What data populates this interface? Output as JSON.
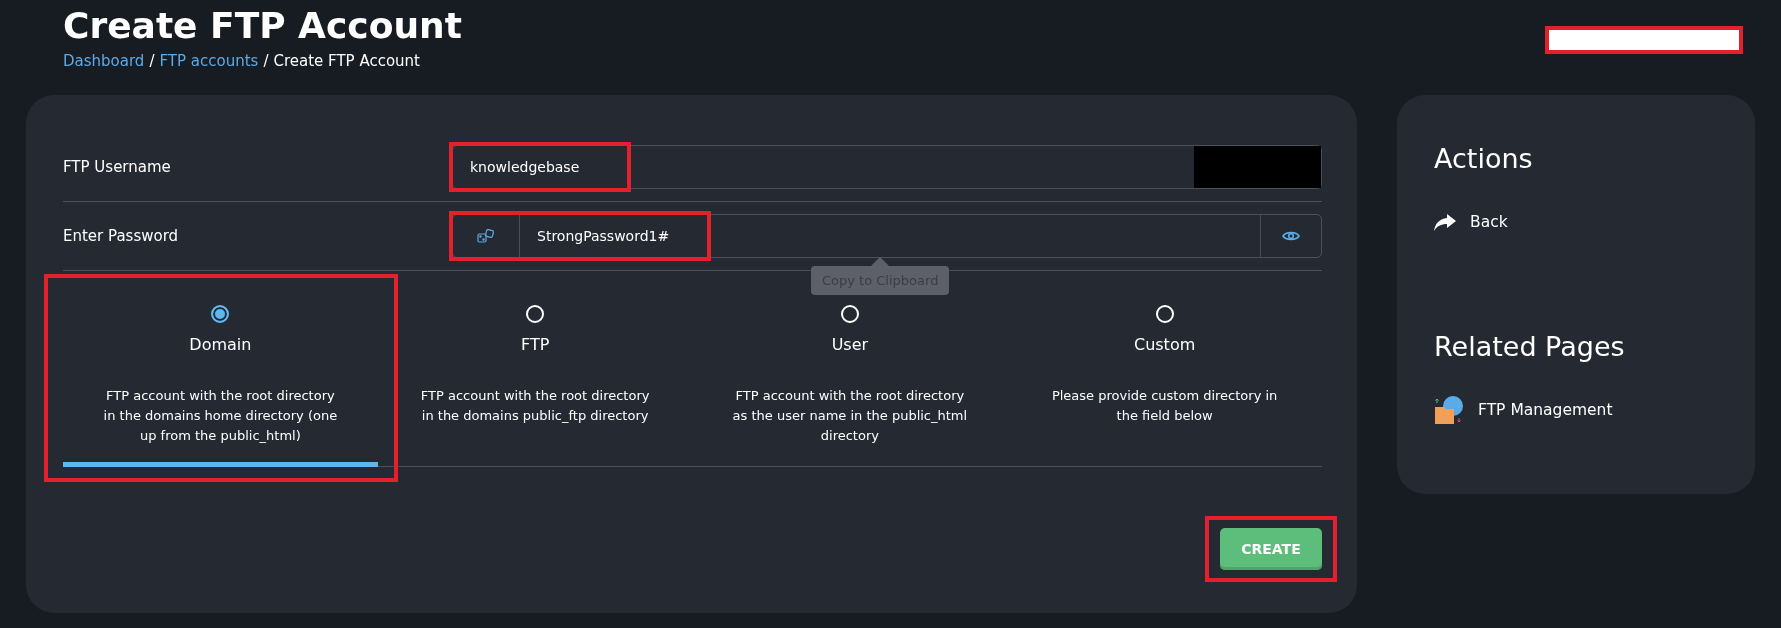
{
  "page": {
    "title": "Create FTP Account"
  },
  "breadcrumb": [
    {
      "label": "Dashboard",
      "kind": "link"
    },
    {
      "label": "/",
      "kind": "separator"
    },
    {
      "label": "FTP accounts",
      "kind": "link"
    },
    {
      "label": "/",
      "kind": "separator"
    },
    {
      "label": "Create FTP Account",
      "kind": "current"
    }
  ],
  "header_redacted": true,
  "form": {
    "fields": [
      {
        "kind": "text",
        "label": "FTP Username",
        "value": "knowledgebase",
        "redacted": true,
        "highlighted": true
      },
      {
        "kind": "password",
        "label": "Enter Password",
        "value": "StrongPassword1#",
        "highlighted": true,
        "tooltip": "Copy to Clipboard"
      }
    ],
    "directory_options": [
      {
        "label": "Domain",
        "description": "FTP account with the root directory\nin the domains home directory (one\nup from the public_html)",
        "selected": true,
        "highlighted": true
      },
      {
        "label": "FTP",
        "description": "FTP account with the root directory\nin the domains public_ftp directory",
        "selected": false,
        "highlighted": false
      },
      {
        "label": "User",
        "description": "FTP account with the root directory\nas the user name in the public_html\ndirectory",
        "selected": false,
        "highlighted": false
      },
      {
        "label": "Custom",
        "description": "Please provide custom directory in\nthe field below",
        "selected": false,
        "highlighted": false
      }
    ],
    "create_button": {
      "label": "CREATE",
      "highlighted": true
    }
  },
  "sidebar": {
    "actions_title": "Actions",
    "actions": [
      {
        "label": "Back",
        "kind": "back"
      }
    ],
    "related_title": "Related Pages",
    "related": [
      {
        "label": "FTP Management",
        "kind": "ftp"
      }
    ]
  }
}
